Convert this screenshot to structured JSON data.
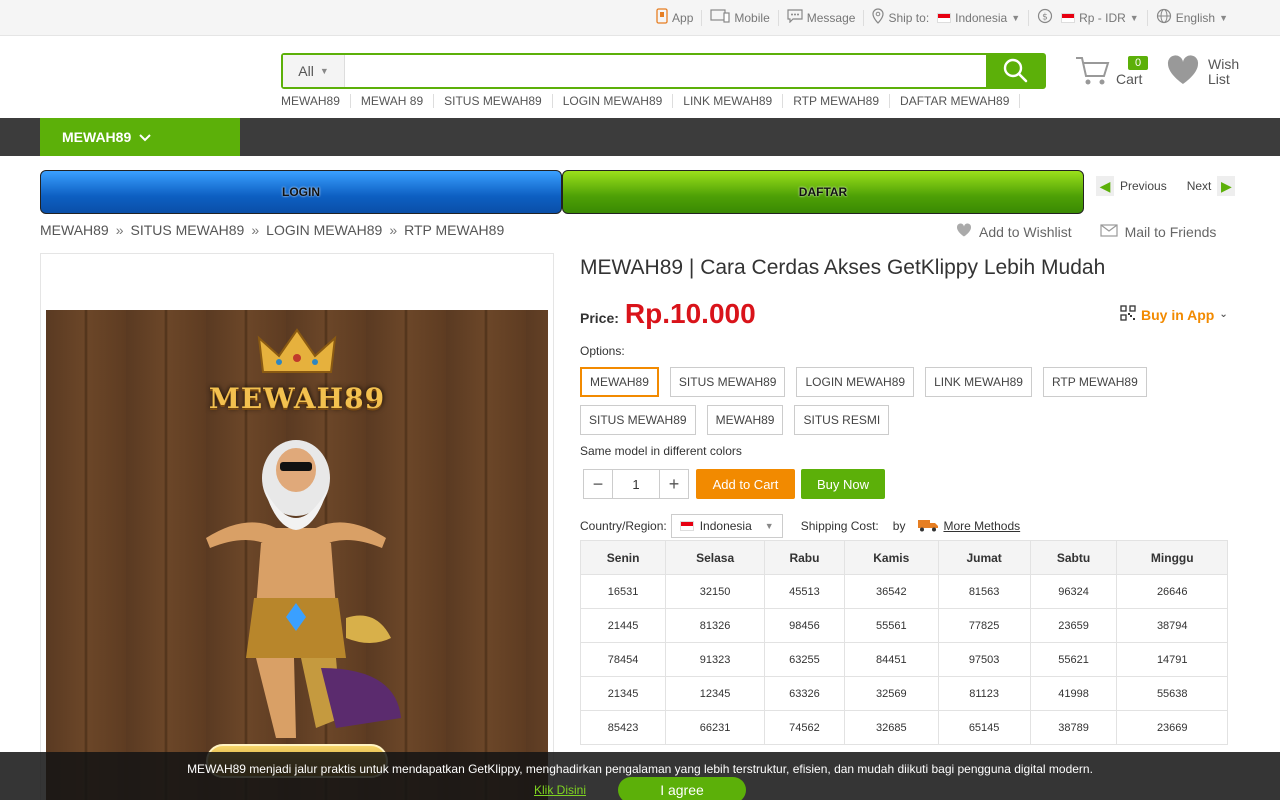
{
  "topbar": {
    "app": "App",
    "mobile": "Mobile",
    "message": "Message",
    "ship_to_label": "Ship to:",
    "ship_to_value": "Indonesia",
    "currency": "Rp - IDR",
    "language": "English"
  },
  "search": {
    "category": "All",
    "placeholder": "",
    "hotwords": [
      "MEWAH89",
      "MEWAH 89",
      "SITUS MEWAH89",
      "LOGIN MEWAH89",
      "LINK MEWAH89",
      "RTP MEWAH89",
      "DAFTAR MEWAH89"
    ]
  },
  "cart": {
    "count": "0",
    "label": "Cart"
  },
  "wishlist": {
    "label": "Wish List"
  },
  "nav": {
    "category": "MEWAH89"
  },
  "banners": {
    "login": "LOGIN",
    "daftar": "DAFTAR"
  },
  "pager": {
    "previous": "Previous",
    "next": "Next"
  },
  "breadcrumb": [
    "MEWAH89",
    "SITUS MEWAH89",
    "LOGIN MEWAH89",
    "RTP MEWAH89"
  ],
  "actions": {
    "wishlist": "Add to Wishlist",
    "mail": "Mail to Friends"
  },
  "product": {
    "image_brand": "MEWAH89",
    "title": "MEWAH89 | Cara Cerdas Akses GetKlippy Lebih Mudah",
    "price_label": "Price:",
    "price_value": "Rp.10.000",
    "buy_in_app": "Buy in App",
    "options_label": "Options:",
    "options": [
      "MEWAH89",
      "SITUS MEWAH89",
      "LOGIN MEWAH89",
      "LINK MEWAH89",
      "RTP MEWAH89",
      "SITUS MEWAH89",
      "MEWAH89",
      "SITUS RESMI"
    ],
    "selected_option": 0,
    "same_model": "Same model in different colors",
    "quantity": "1",
    "add_to_cart": "Add to Cart",
    "buy_now": "Buy Now",
    "country_label": "Country/Region:",
    "country_value": "Indonesia",
    "shipping_cost": "Shipping Cost:",
    "shipping_by": "by",
    "more_methods": "More Methods"
  },
  "table": {
    "headers": [
      "Senin",
      "Selasa",
      "Rabu",
      "Kamis",
      "Jumat",
      "Sabtu",
      "Minggu"
    ],
    "rows": [
      [
        "16531",
        "32150",
        "45513",
        "36542",
        "81563",
        "96324",
        "26646"
      ],
      [
        "21445",
        "81326",
        "98456",
        "55561",
        "77825",
        "23659",
        "38794"
      ],
      [
        "78454",
        "91323",
        "63255",
        "84451",
        "97503",
        "55621",
        "14791"
      ],
      [
        "21345",
        "12345",
        "63326",
        "32569",
        "81123",
        "41998",
        "55638"
      ],
      [
        "85423",
        "66231",
        "74562",
        "32685",
        "65145",
        "38789",
        "23669"
      ]
    ]
  },
  "cookie": {
    "message": "MEWAH89 menjadi jalur praktis untuk mendapatkan GetKlippy, menghadirkan pengalaman yang lebih terstruktur, efisien, dan mudah diikuti bagi pengguna digital modern.",
    "link": "Klik Disini",
    "agree": "I agree"
  },
  "colors": {
    "accent": "#5cb009",
    "orange": "#f28a00",
    "price": "#d9131a",
    "nav": "#3c3c3c"
  }
}
